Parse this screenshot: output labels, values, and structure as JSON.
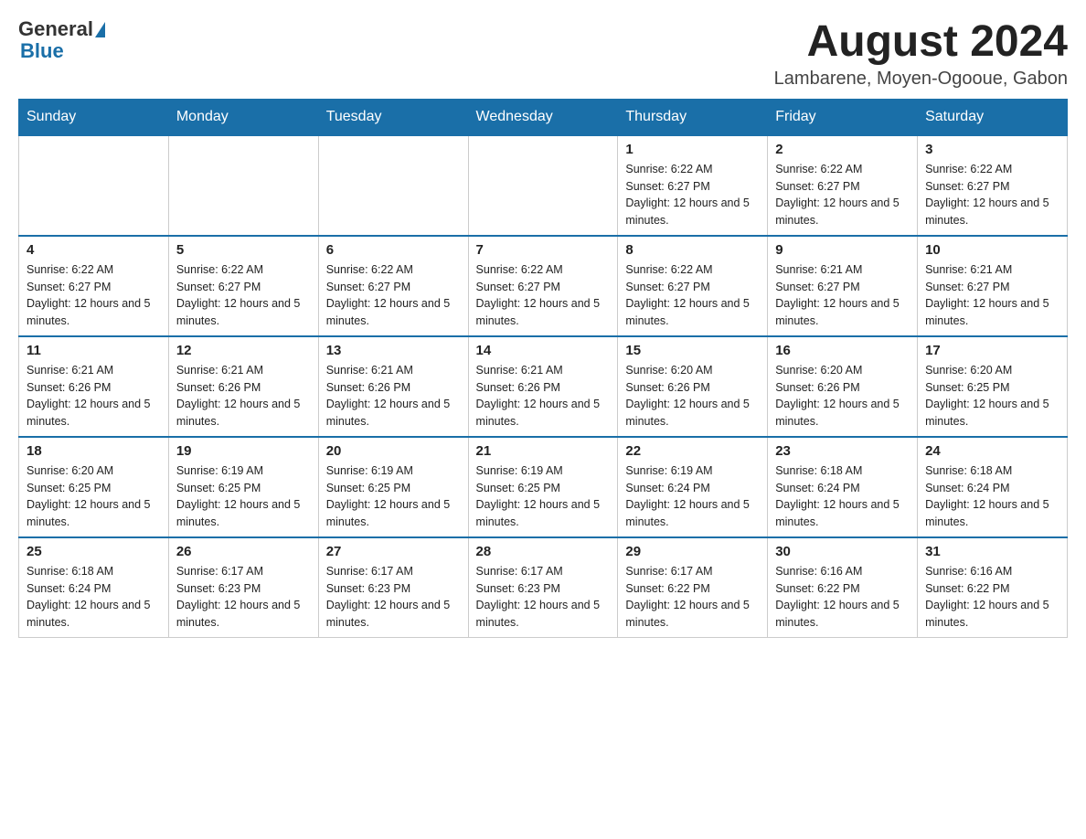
{
  "header": {
    "logo_general": "General",
    "logo_blue": "Blue",
    "month_title": "August 2024",
    "location": "Lambarene, Moyen-Ogooue, Gabon"
  },
  "days_of_week": [
    "Sunday",
    "Monday",
    "Tuesday",
    "Wednesday",
    "Thursday",
    "Friday",
    "Saturday"
  ],
  "weeks": [
    [
      {
        "day": "",
        "info": ""
      },
      {
        "day": "",
        "info": ""
      },
      {
        "day": "",
        "info": ""
      },
      {
        "day": "",
        "info": ""
      },
      {
        "day": "1",
        "info": "Sunrise: 6:22 AM\nSunset: 6:27 PM\nDaylight: 12 hours and 5 minutes."
      },
      {
        "day": "2",
        "info": "Sunrise: 6:22 AM\nSunset: 6:27 PM\nDaylight: 12 hours and 5 minutes."
      },
      {
        "day": "3",
        "info": "Sunrise: 6:22 AM\nSunset: 6:27 PM\nDaylight: 12 hours and 5 minutes."
      }
    ],
    [
      {
        "day": "4",
        "info": "Sunrise: 6:22 AM\nSunset: 6:27 PM\nDaylight: 12 hours and 5 minutes."
      },
      {
        "day": "5",
        "info": "Sunrise: 6:22 AM\nSunset: 6:27 PM\nDaylight: 12 hours and 5 minutes."
      },
      {
        "day": "6",
        "info": "Sunrise: 6:22 AM\nSunset: 6:27 PM\nDaylight: 12 hours and 5 minutes."
      },
      {
        "day": "7",
        "info": "Sunrise: 6:22 AM\nSunset: 6:27 PM\nDaylight: 12 hours and 5 minutes."
      },
      {
        "day": "8",
        "info": "Sunrise: 6:22 AM\nSunset: 6:27 PM\nDaylight: 12 hours and 5 minutes."
      },
      {
        "day": "9",
        "info": "Sunrise: 6:21 AM\nSunset: 6:27 PM\nDaylight: 12 hours and 5 minutes."
      },
      {
        "day": "10",
        "info": "Sunrise: 6:21 AM\nSunset: 6:27 PM\nDaylight: 12 hours and 5 minutes."
      }
    ],
    [
      {
        "day": "11",
        "info": "Sunrise: 6:21 AM\nSunset: 6:26 PM\nDaylight: 12 hours and 5 minutes."
      },
      {
        "day": "12",
        "info": "Sunrise: 6:21 AM\nSunset: 6:26 PM\nDaylight: 12 hours and 5 minutes."
      },
      {
        "day": "13",
        "info": "Sunrise: 6:21 AM\nSunset: 6:26 PM\nDaylight: 12 hours and 5 minutes."
      },
      {
        "day": "14",
        "info": "Sunrise: 6:21 AM\nSunset: 6:26 PM\nDaylight: 12 hours and 5 minutes."
      },
      {
        "day": "15",
        "info": "Sunrise: 6:20 AM\nSunset: 6:26 PM\nDaylight: 12 hours and 5 minutes."
      },
      {
        "day": "16",
        "info": "Sunrise: 6:20 AM\nSunset: 6:26 PM\nDaylight: 12 hours and 5 minutes."
      },
      {
        "day": "17",
        "info": "Sunrise: 6:20 AM\nSunset: 6:25 PM\nDaylight: 12 hours and 5 minutes."
      }
    ],
    [
      {
        "day": "18",
        "info": "Sunrise: 6:20 AM\nSunset: 6:25 PM\nDaylight: 12 hours and 5 minutes."
      },
      {
        "day": "19",
        "info": "Sunrise: 6:19 AM\nSunset: 6:25 PM\nDaylight: 12 hours and 5 minutes."
      },
      {
        "day": "20",
        "info": "Sunrise: 6:19 AM\nSunset: 6:25 PM\nDaylight: 12 hours and 5 minutes."
      },
      {
        "day": "21",
        "info": "Sunrise: 6:19 AM\nSunset: 6:25 PM\nDaylight: 12 hours and 5 minutes."
      },
      {
        "day": "22",
        "info": "Sunrise: 6:19 AM\nSunset: 6:24 PM\nDaylight: 12 hours and 5 minutes."
      },
      {
        "day": "23",
        "info": "Sunrise: 6:18 AM\nSunset: 6:24 PM\nDaylight: 12 hours and 5 minutes."
      },
      {
        "day": "24",
        "info": "Sunrise: 6:18 AM\nSunset: 6:24 PM\nDaylight: 12 hours and 5 minutes."
      }
    ],
    [
      {
        "day": "25",
        "info": "Sunrise: 6:18 AM\nSunset: 6:24 PM\nDaylight: 12 hours and 5 minutes."
      },
      {
        "day": "26",
        "info": "Sunrise: 6:17 AM\nSunset: 6:23 PM\nDaylight: 12 hours and 5 minutes."
      },
      {
        "day": "27",
        "info": "Sunrise: 6:17 AM\nSunset: 6:23 PM\nDaylight: 12 hours and 5 minutes."
      },
      {
        "day": "28",
        "info": "Sunrise: 6:17 AM\nSunset: 6:23 PM\nDaylight: 12 hours and 5 minutes."
      },
      {
        "day": "29",
        "info": "Sunrise: 6:17 AM\nSunset: 6:22 PM\nDaylight: 12 hours and 5 minutes."
      },
      {
        "day": "30",
        "info": "Sunrise: 6:16 AM\nSunset: 6:22 PM\nDaylight: 12 hours and 5 minutes."
      },
      {
        "day": "31",
        "info": "Sunrise: 6:16 AM\nSunset: 6:22 PM\nDaylight: 12 hours and 5 minutes."
      }
    ]
  ]
}
